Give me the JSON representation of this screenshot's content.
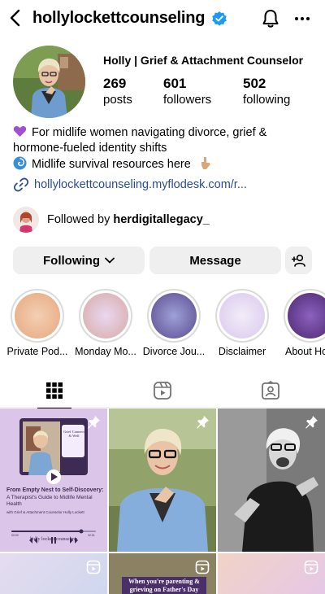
{
  "header": {
    "username": "hollylockettcounseling"
  },
  "profile": {
    "display_name": "Holly | Grief & Attachment Counselor",
    "stats": [
      {
        "value": "269",
        "label": "posts"
      },
      {
        "value": "601",
        "label": "followers"
      },
      {
        "value": "502",
        "label": "following"
      }
    ],
    "bio_lines": [
      "For midlife women navigating divorce, grief &",
      "hormone-fueled identity shifts",
      "Midlife survival resources here"
    ],
    "link": "hollylockettcounseling.myflodesk.com/r...",
    "followed_by_prefix": "Followed by",
    "followed_by_user": "herdigitallegacy_"
  },
  "actions": {
    "following_label": "Following",
    "message_label": "Message"
  },
  "highlights": [
    {
      "label": "Private Pod...",
      "color_center": "#f3cfb4",
      "color_edge": "#e7a77c"
    },
    {
      "label": "Monday Mo...",
      "color_center": "#ead7f0",
      "color_edge": "#d7a9a4"
    },
    {
      "label": "Divorce Jou...",
      "color_center": "#9ea1d8",
      "color_edge": "#5b4a8f"
    },
    {
      "label": "Disclaimer",
      "color_center": "#f2edf8",
      "color_edge": "#d9c7ee"
    },
    {
      "label": "About Ho",
      "color_center": "#8a61be",
      "color_edge": "#4d2770"
    }
  ],
  "tiles": {
    "podcast": {
      "title": "From Empty Nest to Self-Discovery:",
      "subtitle": "A Therapist's Guide to Midlife Mental Health",
      "with": "with Grief & Attachment Counselor Holly Lockett",
      "brand": "holly lockett counseling",
      "cover_text": "Grief Connect & Well",
      "time_start": "00:00",
      "time_end": "32:01"
    },
    "father_day_caption": "When you're parenting & grieving on Father's Day"
  },
  "colors": {
    "link": "#2b4d92",
    "verified": "#1d9bf0",
    "button_bg": "#efefef"
  }
}
